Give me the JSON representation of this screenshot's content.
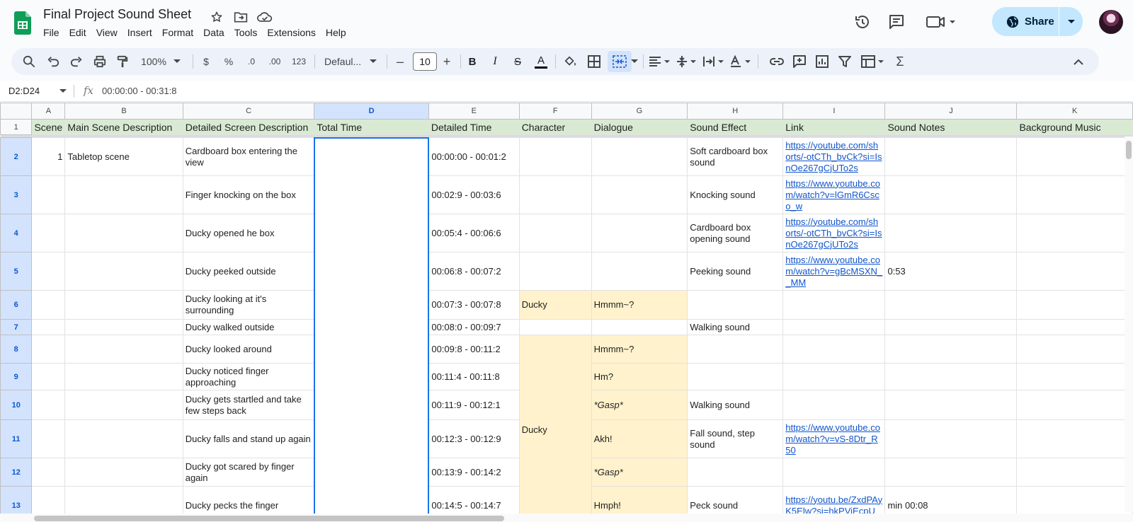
{
  "doc": {
    "title": "Final Project Sound Sheet",
    "icons": [
      "star-icon",
      "move-to-folder-icon",
      "cloud-status-icon"
    ]
  },
  "menu": [
    "File",
    "Edit",
    "View",
    "Insert",
    "Format",
    "Data",
    "Tools",
    "Extensions",
    "Help"
  ],
  "actions": {
    "share_label": "Share",
    "icons": [
      "version-history-icon",
      "comments-icon",
      "meet-icon",
      "share-dropdown-icon",
      "avatar"
    ]
  },
  "toolbar": {
    "zoom": "100%",
    "currency": "$",
    "percent": "%",
    "decrease_decimal": ".0",
    "increase_decimal": ".00",
    "number_format": "123",
    "font": "Defaul...",
    "font_size": "10",
    "minus": "–",
    "plus": "+",
    "bold": "B",
    "italic": "I",
    "strike": "S",
    "text_color": "A",
    "sigma": "Σ"
  },
  "formula": {
    "namebox": "D2:D24",
    "fx": "fx",
    "value": "00:00:00 - 00:31:8"
  },
  "columns": [
    "A",
    "B",
    "C",
    "D",
    "E",
    "F",
    "G",
    "H",
    "I",
    "J",
    "K"
  ],
  "headers": [
    "Scene",
    "Main Scene Description",
    "Detailed Screen Description",
    "Total Time",
    "Detailed Time",
    "Character",
    "Dialogue",
    "Sound Effect",
    "Link",
    "Sound Notes",
    "Background Music"
  ],
  "rows": [
    {
      "n": "2",
      "scene": "1",
      "main": "Tabletop scene",
      "detail": "Cardboard box entering the view",
      "time": "00:00:00 - 00:01:2",
      "char": "",
      "dialogue": "",
      "effect": "Soft cardboard box sound",
      "link": "https://youtube.com/shorts/-otCTh_bvCk?si=IsnOe267gCjUTo2s",
      "notes": ""
    },
    {
      "n": "3",
      "scene": "",
      "main": "",
      "detail": "Finger knocking on the box",
      "time": "00:02:9 - 00:03:6",
      "char": "",
      "dialogue": "",
      "effect": "Knocking sound",
      "link": "https://www.youtube.com/watch?v=lGmR6Csco_w",
      "notes": ""
    },
    {
      "n": "4",
      "scene": "",
      "main": "",
      "detail": "Ducky opened he box",
      "time": "00:05:4 - 00:06:6",
      "char": "",
      "dialogue": "",
      "effect": "Cardboard box opening sound",
      "link": "https://youtube.com/shorts/-otCTh_bvCk?si=IsnOe267gCjUTo2s",
      "notes": ""
    },
    {
      "n": "5",
      "scene": "",
      "main": "",
      "detail": "Ducky peeked outside",
      "time": "00:06:8 - 00:07:2",
      "char": "",
      "dialogue": "",
      "effect": "Peeking sound",
      "link": "https://www.youtube.com/watch?v=gBcMSXN__MM",
      "notes": "0:53"
    },
    {
      "n": "6",
      "scene": "",
      "main": "",
      "detail": "Ducky looking at it's surrounding",
      "time": "00:07:3 - 00:07:8",
      "char": "Ducky",
      "dialogue": "Hmmm~?",
      "effect": "",
      "link": "",
      "notes": ""
    },
    {
      "n": "7",
      "scene": "",
      "main": "",
      "detail": "Ducky walked outside",
      "time": "00:08:0 - 00:09:7",
      "char": "",
      "dialogue": "",
      "effect": "Walking sound",
      "link": "",
      "notes": ""
    },
    {
      "n": "8",
      "scene": "",
      "main": "",
      "detail": "Ducky looked around",
      "time": "00:09:8 - 00:11:2",
      "char": "Ducky",
      "dialogue": "Hmmm~?",
      "effect": "",
      "link": "",
      "notes": ""
    },
    {
      "n": "9",
      "scene": "",
      "main": "",
      "detail": "Ducky noticed finger approaching",
      "time": "00:11:4 - 00:11:8",
      "char": "",
      "dialogue": "Hm?",
      "effect": "",
      "link": "",
      "notes": ""
    },
    {
      "n": "10",
      "scene": "",
      "main": "",
      "detail": "Ducky gets startled and take few steps back",
      "time": "00:11:9 - 00:12:1",
      "char": "",
      "dialogue": "*Gasp*",
      "effect": "Walking sound",
      "link": "",
      "notes": ""
    },
    {
      "n": "11",
      "scene": "",
      "main": "",
      "detail": "Ducky falls and stand up again",
      "time": "00:12:3 - 00:12:9",
      "char": "",
      "dialogue": "Akh!",
      "effect": "Fall sound, step sound",
      "link": "https://www.youtube.com/watch?v=vS-8Dtr_R50",
      "notes": ""
    },
    {
      "n": "12",
      "scene": "",
      "main": "",
      "detail": "Ducky got scared by finger again",
      "time": "00:13:9 - 00:14:2",
      "char": "",
      "dialogue": "*Gasp*",
      "effect": "",
      "link": "",
      "notes": ""
    },
    {
      "n": "13",
      "scene": "",
      "main": "",
      "detail": "Ducky pecks the finger",
      "time": "00:14:5 - 00:14:7",
      "char": "",
      "dialogue": "Hmph!",
      "effect": "Peck sound",
      "link": "https://youtu.be/ZxdPAyK5Elw?si=hkPViEcpU",
      "notes": "min 00:08"
    }
  ],
  "colors": {
    "header_bg": "#d9ead3",
    "dialogue_bg": "#fff2cc",
    "selection": "#1a73e8",
    "share_bg": "#c2e7ff",
    "link": "#1155cc"
  }
}
